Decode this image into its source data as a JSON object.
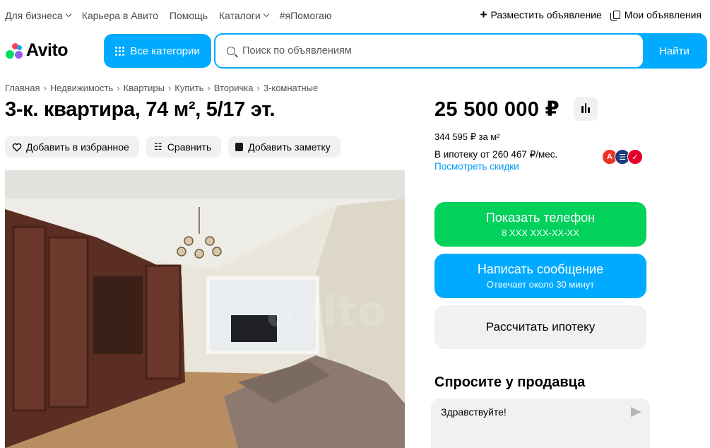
{
  "topnav": {
    "items": [
      "Для бизнеса",
      "Карьера в Авито",
      "Помощь",
      "Каталоги",
      "#яПомогаю"
    ],
    "post_ad": "Разместить объявление",
    "my_ads": "Мои объявления"
  },
  "header": {
    "logo_text": "Avito",
    "categories_label": "Все категории",
    "search_placeholder": "Поиск по объявлениям",
    "search_button": "Найти"
  },
  "breadcrumb": [
    "Главная",
    "Недвижимость",
    "Квартиры",
    "Купить",
    "Вторичка",
    "3-комнатные"
  ],
  "listing": {
    "title": "3-к. квартира, 74 м², 5/17 эт.",
    "actions": {
      "favorite": "Добавить в избранное",
      "compare": "Сравнить",
      "note": "Добавить заметку"
    }
  },
  "sidebar": {
    "price": "25 500 000 ₽",
    "price_per_meter": "344 595 ₽ за м²",
    "mortgage_text": "В ипотеку от 260 467 ₽/мес.",
    "discounts_link": "Посмотреть скидки",
    "bank_logos": [
      "А",
      "☰",
      "✓"
    ],
    "show_phone": "Показать телефон",
    "phone_masked": "8 XXX XXX-XX-XX",
    "write_message": "Написать сообщение",
    "response_time": "Отвечает около 30 минут",
    "calc_mortgage": "Рассчитать ипотеку",
    "ask_title": "Спросите у продавца",
    "ask_value": "Здравствуйте!"
  },
  "colors": {
    "accent_blue": "#00aaff",
    "green": "#02d15c",
    "link": "#0099f7",
    "chip_bg": "#f2f1f0"
  }
}
